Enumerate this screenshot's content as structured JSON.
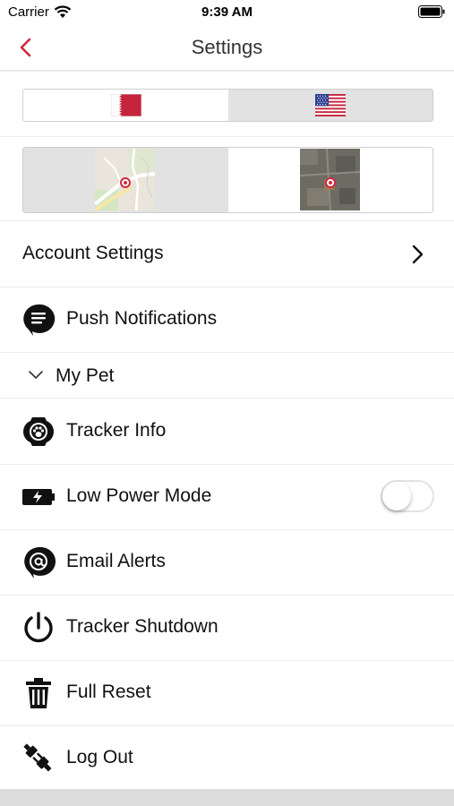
{
  "status_bar": {
    "carrier": "Carrier",
    "time": "9:39 AM"
  },
  "nav": {
    "title": "Settings",
    "back_icon": "chevron-left-icon",
    "accent_color": "#d0283b"
  },
  "language_selector": {
    "options": [
      {
        "icon": "qatar-flag-icon",
        "selected": true
      },
      {
        "icon": "usa-flag-icon",
        "selected": false
      }
    ]
  },
  "map_type_selector": {
    "options": [
      {
        "icon": "street-map-icon",
        "selected": false
      },
      {
        "icon": "satellite-map-icon",
        "selected": true
      }
    ]
  },
  "account_settings": {
    "label": "Account Settings",
    "icon": "chevron-right-icon"
  },
  "push_notifications": {
    "label": "Push Notifications",
    "icon": "chat-bubble-icon"
  },
  "my_pet_section": {
    "label": "My Pet",
    "icon": "chevron-down-icon",
    "expanded": true
  },
  "pet_items": [
    {
      "label": "Tracker Info",
      "icon": "paw-tracker-icon"
    },
    {
      "label": "Low Power Mode",
      "icon": "battery-bolt-icon",
      "toggle": false
    },
    {
      "label": "Email Alerts",
      "icon": "at-sign-icon"
    },
    {
      "label": "Tracker Shutdown",
      "icon": "power-icon"
    },
    {
      "label": "Full Reset",
      "icon": "trash-icon"
    },
    {
      "label": "Log Out",
      "icon": "unplug-icon"
    }
  ]
}
